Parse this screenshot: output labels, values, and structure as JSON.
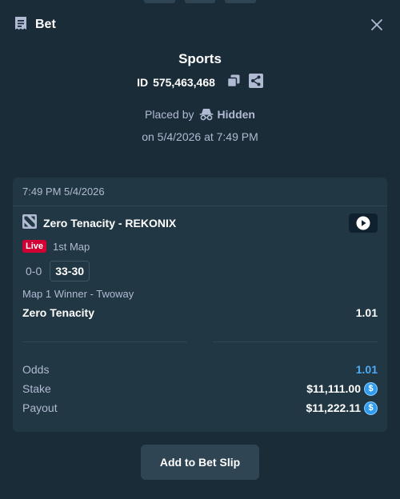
{
  "header": {
    "title": "Bet",
    "icon": "receipt-icon",
    "close_icon": "close-icon"
  },
  "bet": {
    "category": "Sports",
    "id_label": "ID",
    "id_value": "575,463,468",
    "placed_by_label": "Placed by",
    "placed_by_user": "Hidden",
    "placed_on": "on 5/4/2026 at 7:49 PM"
  },
  "card": {
    "time": "7:49 PM 5/4/2026",
    "match": "Zero Tenacity - REKONIX",
    "live_badge": "Live",
    "map": "1st Map",
    "score_series": "0-0",
    "score_map": "33-30",
    "market": "Map 1 Winner - Twoway",
    "selection": "Zero Tenacity",
    "selection_odds": "1.01"
  },
  "summary": {
    "odds_label": "Odds",
    "odds_value": "1.01",
    "stake_label": "Stake",
    "stake_value": "$11,111.00",
    "payout_label": "Payout",
    "payout_value": "$11,222.11",
    "currency_symbol": "$"
  },
  "actions": {
    "add_label": "Add to Bet Slip"
  },
  "colors": {
    "background": "#1a2c38",
    "card": "#213743",
    "live": "#d20035",
    "odds": "#4dabf7",
    "coin": "#2e9cf2"
  }
}
